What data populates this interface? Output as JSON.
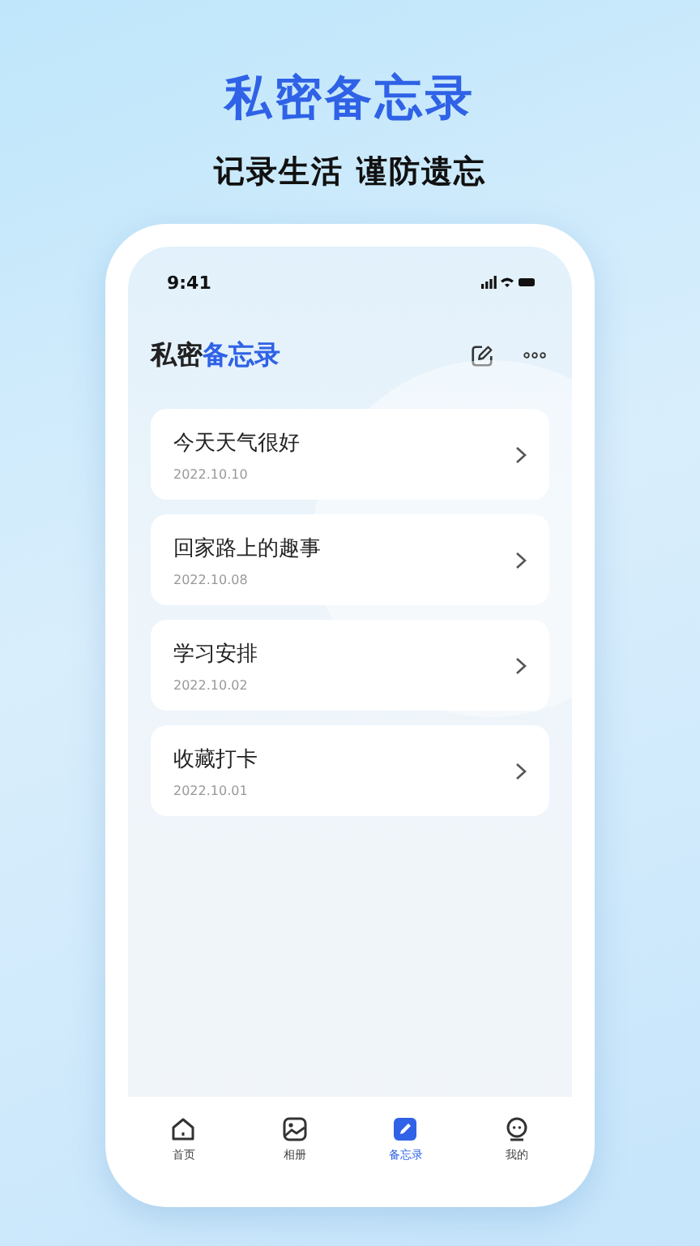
{
  "headline": "私密备忘录",
  "subheadline": "记录生活 谨防遗忘",
  "phone": {
    "status_time": "9:41",
    "title_plain": "私密",
    "title_accent": "备忘录",
    "notes": [
      {
        "title": "今天天气很好",
        "date": "2022.10.10"
      },
      {
        "title": "回家路上的趣事",
        "date": "2022.10.08"
      },
      {
        "title": "学习安排",
        "date": "2022.10.02"
      },
      {
        "title": "收藏打卡",
        "date": "2022.10.01"
      }
    ],
    "tabs": [
      {
        "label": "首页",
        "kind": "home",
        "selected": false
      },
      {
        "label": "相册",
        "kind": "album",
        "selected": false
      },
      {
        "label": "备忘录",
        "kind": "memo",
        "selected": true
      },
      {
        "label": "我的",
        "kind": "profile",
        "selected": false
      }
    ]
  }
}
